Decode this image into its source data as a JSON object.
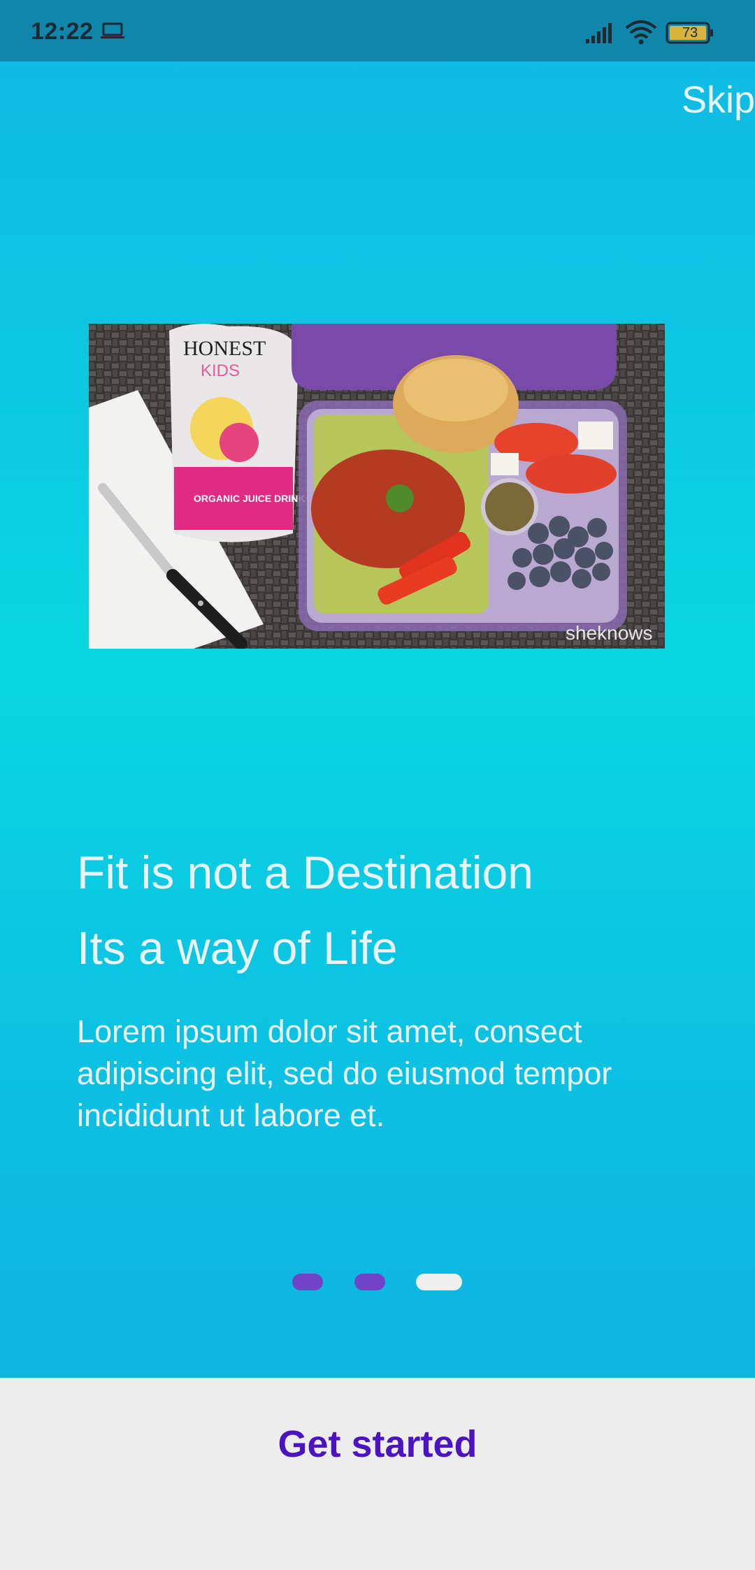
{
  "status_bar": {
    "time": "12:22",
    "battery": "73",
    "icons": [
      "laptop-icon",
      "signal-icon",
      "wifi-icon",
      "battery-icon"
    ]
  },
  "onboarding": {
    "skip_label": "Skip",
    "headline_line1": "Fit is not a Destination",
    "headline_line2": "Its a way of Life",
    "body": "Lorem ipsum dolor sit amet, consect adipiscing elit, sed do eiusmod tempor incididunt ut labore et.",
    "image_watermark": "sheknows",
    "image_brand_top": "HONEST",
    "image_brand_sub": "KIDS",
    "image_pouch_label": "ORGANIC JUICE DRINK",
    "page_count": 3,
    "current_page": 3
  },
  "footer": {
    "cta_label": "Get started"
  },
  "colors": {
    "status_bar": "#0f86aa",
    "background_top": "#10b8e4",
    "dot_active": "#7043c8",
    "dot_inactive": "#efefef",
    "cta_text": "#4c13c2",
    "footer_bg": "#ededed"
  }
}
